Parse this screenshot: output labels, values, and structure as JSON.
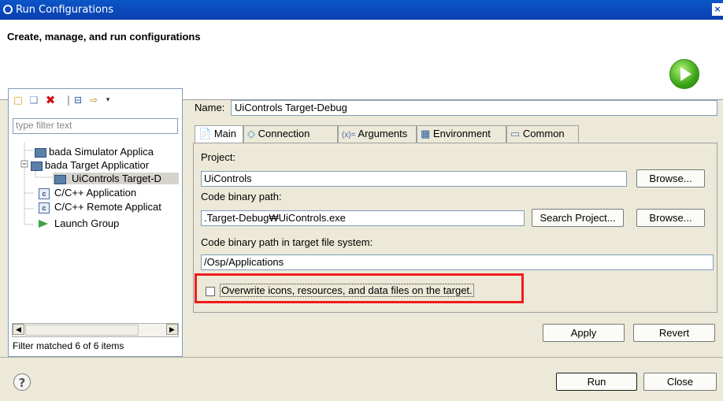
{
  "window": {
    "title": "Run Configurations"
  },
  "header": {
    "title": "Create, manage, and run configurations"
  },
  "left": {
    "filter_placeholder": "type filter text",
    "tree": [
      {
        "label": "bada Simulator Applica"
      },
      {
        "label": "bada Target Applicatior"
      },
      {
        "label": "UiControls Target-D"
      },
      {
        "label": "C/C++ Application"
      },
      {
        "label": "C/C++ Remote Applicat"
      },
      {
        "label": "Launch Group"
      }
    ],
    "filter_status": "Filter matched 6 of 6 items"
  },
  "name": {
    "label": "Name:",
    "value": "UiControls Target-Debug"
  },
  "tabs": [
    {
      "label": "Main",
      "active": true
    },
    {
      "label": "Connection"
    },
    {
      "label": "Arguments"
    },
    {
      "label": "Environment"
    },
    {
      "label": "Common"
    }
  ],
  "main": {
    "project_label": "Project:",
    "project_value": "UiControls",
    "browse1": "Browse...",
    "binary_label": "Code binary path:",
    "binary_value": ".Target-Debug₩UiControls.exe",
    "search_project": "Search Project...",
    "browse2": "Browse...",
    "target_label": "Code binary path in target file system:",
    "target_value": "/Osp/Applications",
    "overwrite_label": "Overwrite icons, resources, and data files on the target."
  },
  "buttons": {
    "apply": "Apply",
    "revert": "Revert",
    "run": "Run",
    "close": "Close"
  }
}
